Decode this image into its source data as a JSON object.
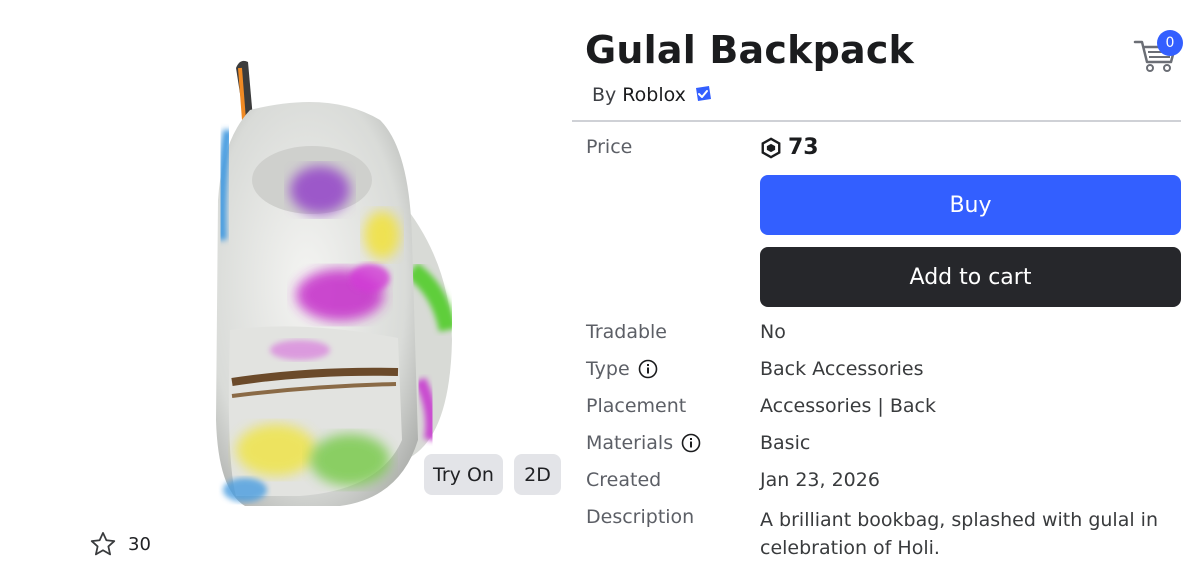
{
  "item": {
    "title": "Gulal Backpack",
    "by_prefix": "By",
    "creator": "Roblox",
    "verified_icon": "verified-badge-icon"
  },
  "header": {
    "cart_count": "0",
    "cart_icon": "cart-icon"
  },
  "preview": {
    "try_on_label": "Try On",
    "two_d_label": "2D",
    "favorite_count": "30",
    "favorite_icon": "star-outline-icon"
  },
  "price": {
    "label": "Price",
    "amount": "73",
    "currency_icon": "robux-icon"
  },
  "actions": {
    "buy_label": "Buy",
    "add_to_cart_label": "Add to cart"
  },
  "details": {
    "tradable_label": "Tradable",
    "tradable_value": "No",
    "type_label": "Type",
    "type_value": "Back Accessories",
    "placement_label": "Placement",
    "placement_value": "Accessories | Back",
    "materials_label": "Materials",
    "materials_value": "Basic",
    "created_label": "Created",
    "created_value": "Jan 23, 2026",
    "description_label": "Description",
    "description_value": "A brilliant bookbag, splashed with gulal in celebration of Holi."
  },
  "colors": {
    "primary": "#335fff",
    "dark_button": "#26272b"
  }
}
